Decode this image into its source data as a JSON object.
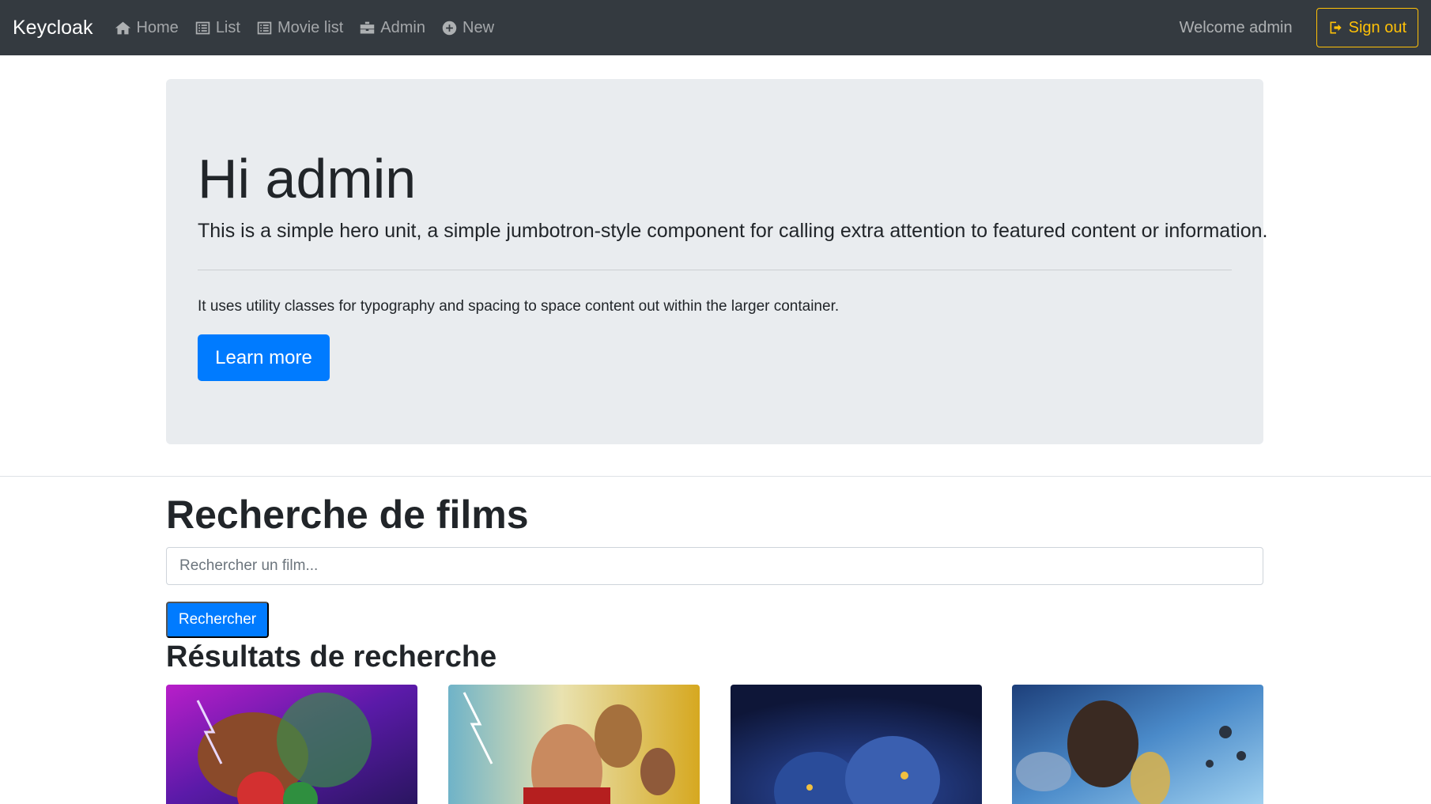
{
  "navbar": {
    "brand": "Keycloak",
    "links": [
      {
        "label": "Home",
        "icon": "home-icon"
      },
      {
        "label": "List",
        "icon": "list-icon"
      },
      {
        "label": "Movie list",
        "icon": "list-icon"
      },
      {
        "label": "Admin",
        "icon": "admin-icon"
      },
      {
        "label": "New",
        "icon": "plus-circle-icon"
      }
    ],
    "welcome": "Welcome admin",
    "signout": "Sign out"
  },
  "hero": {
    "title": "Hi admin",
    "lead": "This is a simple hero unit, a simple jumbotron-style component for calling extra attention to featured content or information.",
    "text": "It uses utility classes for typography and spacing to space content out within the larger container.",
    "button": "Learn more"
  },
  "search": {
    "title": "Recherche de films",
    "placeholder": "Rechercher un film...",
    "button": "Rechercher",
    "results_title": "Résultats de recherche"
  },
  "colors": {
    "navbar_bg": "#343a40",
    "primary": "#007bff",
    "warning": "#ffc107",
    "jumbotron_bg": "#e9ecef"
  }
}
